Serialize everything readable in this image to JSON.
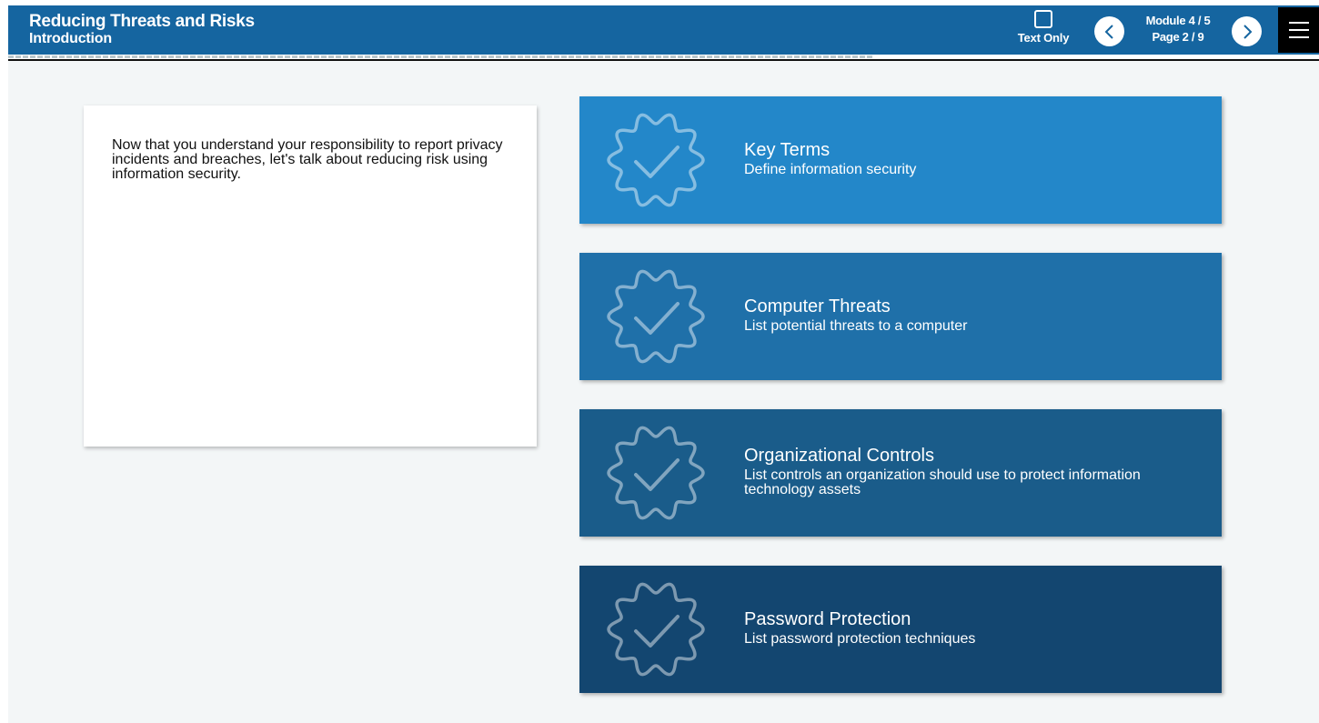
{
  "header": {
    "title": "Reducing Threats and Risks",
    "subtitle": "Introduction",
    "text_only_label": "Text Only",
    "module": "Module 4 / 5",
    "page": "Page 2 / 9",
    "progress_fraction": 0.66
  },
  "intro": {
    "text": "Now that you understand your responsibility to report privacy incidents and breaches, let's talk about reducing risk using information security."
  },
  "topics": [
    {
      "title": "Key Terms",
      "description": "Define information security",
      "color": "#2387c9",
      "icon": "check-badge-icon"
    },
    {
      "title": "Computer Threats",
      "description": "List potential threats to a computer",
      "color": "#1f70a9",
      "icon": "check-badge-icon"
    },
    {
      "title": "Organizational Controls",
      "description": "List controls an organization should use to protect information technology assets",
      "color": "#1a5c8a",
      "icon": "check-badge-icon"
    },
    {
      "title": "Password Protection",
      "description": "List password protection techniques",
      "color": "#134670",
      "icon": "check-badge-icon"
    }
  ],
  "colors": {
    "header": "#1565a0",
    "background": "#f3f6f7",
    "menu": "#000000"
  }
}
